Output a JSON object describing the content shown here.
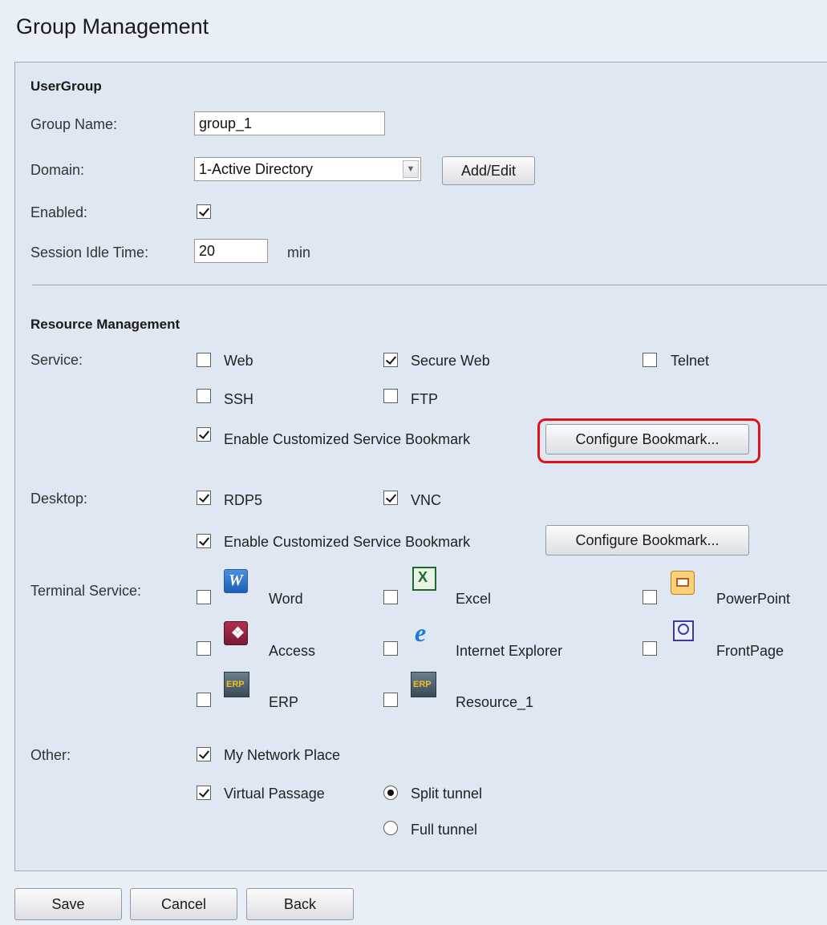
{
  "page_title": "Group Management",
  "user_group": {
    "heading": "UserGroup",
    "group_name_label": "Group Name:",
    "group_name_value": "group_1",
    "domain_label": "Domain:",
    "domain_value": "1-Active Directory",
    "add_edit_label": "Add/Edit",
    "enabled_label": "Enabled:",
    "enabled_checked": true,
    "idle_label": "Session Idle Time:",
    "idle_value": "20",
    "idle_unit": "min"
  },
  "resource_management": {
    "heading": "Resource Management",
    "service": {
      "label": "Service:",
      "web": "Web",
      "secure_web": "Secure Web",
      "telnet": "Telnet",
      "ssh": "SSH",
      "ftp": "FTP",
      "bookmark_label": "Enable Customized Service Bookmark",
      "configure_label": "Configure Bookmark..."
    },
    "desktop": {
      "label": "Desktop:",
      "rdp5": "RDP5",
      "vnc": "VNC",
      "bookmark_label": "Enable Customized Service Bookmark",
      "configure_label": "Configure Bookmark..."
    },
    "terminal_service": {
      "label": "Terminal Service:",
      "word": "Word",
      "excel": "Excel",
      "powerpoint": "PowerPoint",
      "access": "Access",
      "internet_explorer": "Internet Explorer",
      "frontpage": "FrontPage",
      "erp": "ERP",
      "resource_1": "Resource_1",
      "erp_icon_text": "ERP"
    },
    "other": {
      "label": "Other:",
      "my_network_place": "My Network Place",
      "virtual_passage": "Virtual Passage",
      "split_tunnel": "Split tunnel",
      "full_tunnel": "Full tunnel"
    }
  },
  "buttons": {
    "save": "Save",
    "cancel": "Cancel",
    "back": "Back"
  },
  "colors": {
    "highlight": "#e0121c",
    "panel_bg": "#dfe7f2"
  }
}
